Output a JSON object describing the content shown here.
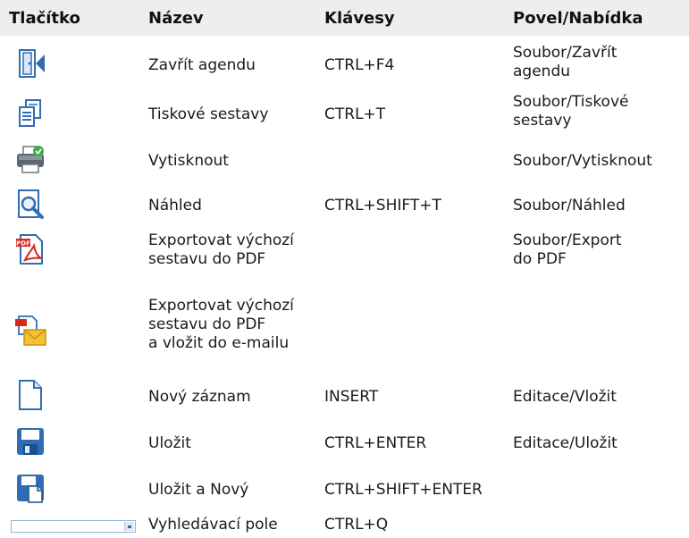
{
  "header": {
    "col_button": "Tlačítko",
    "col_name": "Název",
    "col_keys": "Klávesy",
    "col_command": "Povel/Nabídka"
  },
  "rows": [
    {
      "icon": "close-agenda-icon",
      "name": "Zavřít agendu",
      "keys": "CTRL+F4",
      "command": "Soubor/Zavřít\nagendu"
    },
    {
      "icon": "print-reports-icon",
      "name": "Tiskové sestavy",
      "keys": "CTRL+T",
      "command": "Soubor/Tiskové\nsestavy"
    },
    {
      "icon": "printer-icon",
      "name": "Vytisknout",
      "keys": "",
      "command": "Soubor/Vytisknout"
    },
    {
      "icon": "print-preview-icon",
      "name": "Náhled",
      "keys": "CTRL+SHIFT+T",
      "command": "Soubor/Náhled"
    },
    {
      "icon": "pdf-export-icon",
      "name": "Exportovat výchozí\nsestavu do PDF",
      "keys": "",
      "command": "Soubor/Export\ndo PDF"
    },
    {
      "icon": "pdf-email-icon",
      "name": "Exportovat výchozí\nsestavu do PDF\na vložit do e-mailu",
      "keys": "",
      "command": ""
    },
    {
      "icon": "new-record-icon",
      "name": "Nový záznam",
      "keys": "INSERT",
      "command": "Editace/Vložit"
    },
    {
      "icon": "save-icon",
      "name": "Uložit",
      "keys": "CTRL+ENTER",
      "command": "Editace/Uložit"
    },
    {
      "icon": "save-and-new-icon",
      "name": "Uložit a Nový",
      "keys": "CTRL+SHIFT+ENTER",
      "command": ""
    },
    {
      "icon": "search-field",
      "name": "Vyhledávací pole",
      "keys": "CTRL+Q",
      "command": ""
    }
  ],
  "colors": {
    "header_background": "#eeeeee",
    "icon_blue": "#2f6db5",
    "pdf_red": "#d42a1e",
    "envelope_yellow": "#f2c232"
  }
}
